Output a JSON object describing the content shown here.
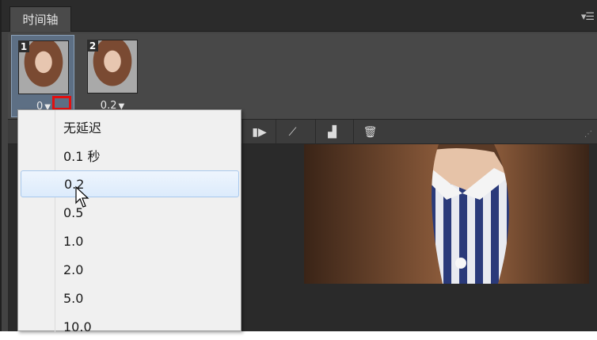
{
  "panel": {
    "tab_label": "时间轴",
    "menu_icon": "panel-menu-icon"
  },
  "frames": [
    {
      "number": "1",
      "delay": "0",
      "selected": true
    },
    {
      "number": "2",
      "delay": "0.2",
      "selected": false
    }
  ],
  "delay_menu": {
    "items": [
      "无延迟",
      "0.1 秒",
      "0.2",
      "0.5",
      "1.0",
      "2.0",
      "5.0",
      "10.0"
    ],
    "hovered": "0.2"
  },
  "toolbar": {
    "icons": [
      "play-next-frame-icon",
      "tween-icon",
      "duplicate-frame-icon",
      "delete-frame-icon"
    ]
  },
  "colors": {
    "panel_bg": "#434343",
    "selected_frame": "#5d6f84",
    "annotation_red": "#e21010",
    "menu_hover": "#dcebfc"
  }
}
